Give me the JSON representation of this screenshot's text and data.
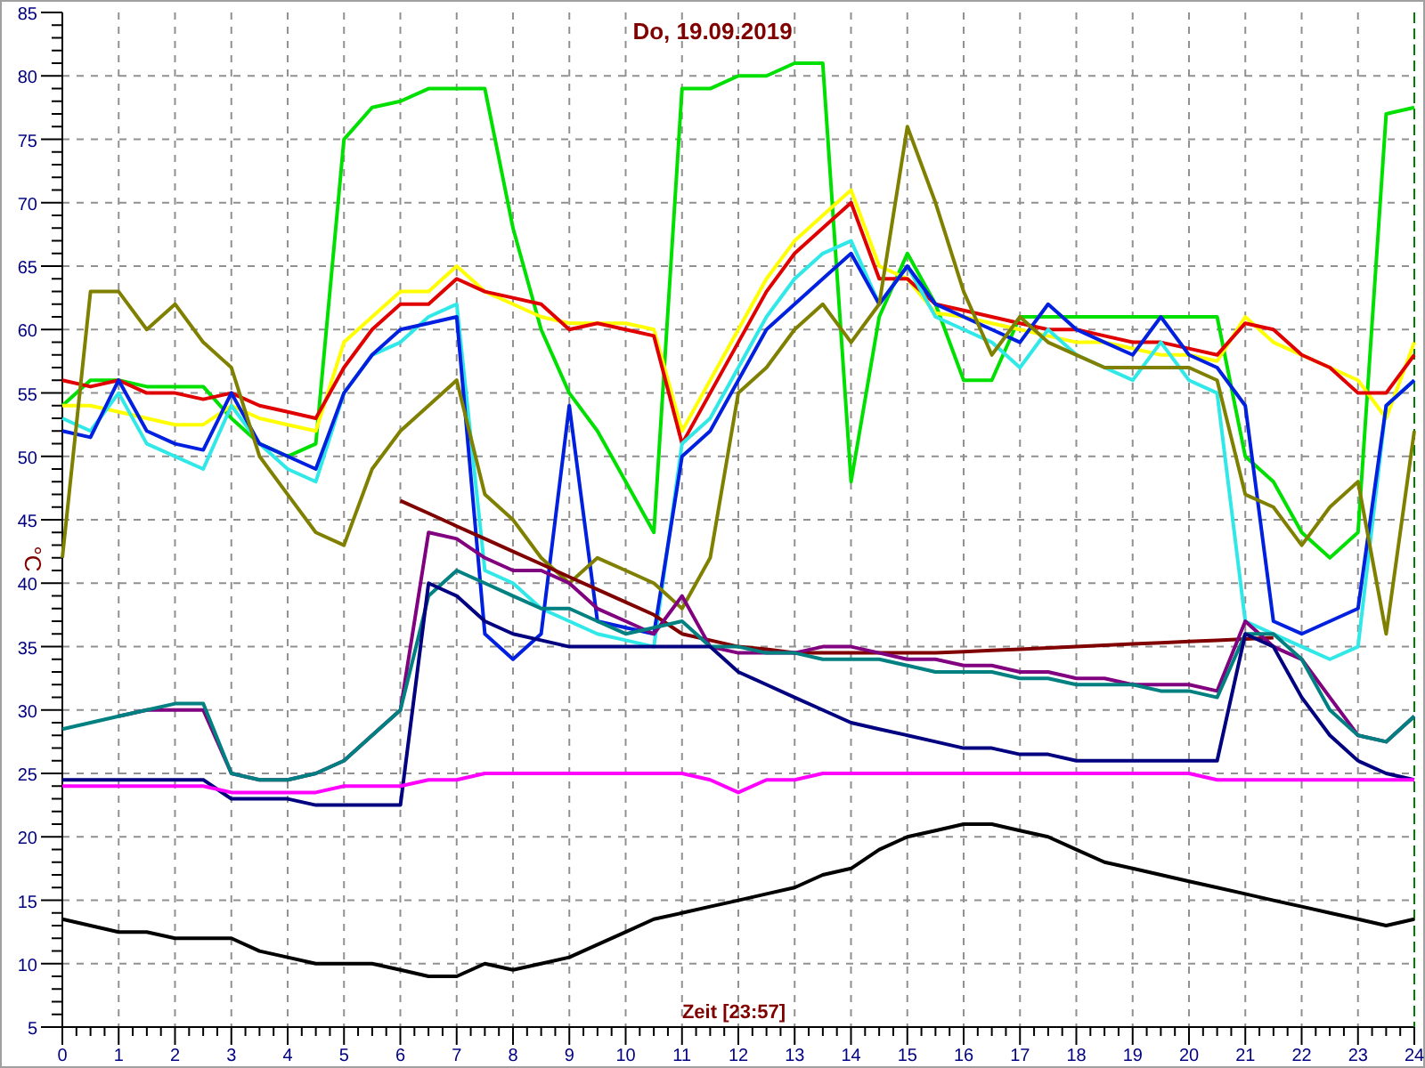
{
  "chart": {
    "chart_data": {
      "type": "line",
      "grid": true,
      "title": "Do, 19.09.2019",
      "xlabel": "Zeit [23:57]",
      "ylabel": "°C",
      "xlim": [
        0,
        24
      ],
      "ylim": [
        5,
        85
      ],
      "xticks": [
        0,
        1,
        2,
        3,
        4,
        5,
        6,
        7,
        8,
        9,
        10,
        11,
        12,
        13,
        14,
        15,
        16,
        17,
        18,
        19,
        20,
        21,
        22,
        23,
        24
      ],
      "yticks": [
        5,
        10,
        15,
        20,
        25,
        30,
        35,
        40,
        45,
        50,
        55,
        60,
        65,
        70,
        75,
        80,
        85
      ],
      "x": [
        0,
        0.5,
        1,
        1.5,
        2,
        2.5,
        3,
        3.5,
        4,
        4.5,
        5,
        5.5,
        6,
        6.5,
        7,
        7.5,
        8,
        8.5,
        9,
        9.5,
        10,
        10.5,
        11,
        11.5,
        12,
        12.5,
        13,
        13.5,
        14,
        14.5,
        15,
        15.5,
        16,
        16.5,
        17,
        17.5,
        18,
        18.5,
        19,
        19.5,
        20,
        20.5,
        21,
        21.5,
        22,
        22.5,
        23,
        23.5,
        24
      ],
      "series": [
        {
          "color": "#00e000",
          "values": [
            54,
            56,
            56,
            55.5,
            55.5,
            55.5,
            53,
            51,
            50,
            51,
            75,
            77.5,
            78,
            79,
            79,
            79,
            68,
            60,
            55,
            52,
            48,
            44,
            79,
            79,
            80,
            80,
            81,
            81,
            48,
            61,
            66,
            62,
            56,
            56,
            61,
            61,
            61,
            61,
            61,
            61,
            61,
            61,
            50,
            48,
            44,
            42,
            44,
            77,
            77.5
          ]
        },
        {
          "color": "#ffff00",
          "values": [
            54,
            54,
            53.5,
            53,
            52.5,
            52.5,
            54,
            53,
            52.5,
            52,
            59,
            61,
            63,
            63,
            65,
            63,
            62,
            61,
            60.5,
            60.5,
            60.5,
            60,
            52,
            56,
            60,
            64,
            67,
            69,
            71,
            65,
            64,
            61.3,
            61,
            60.5,
            60,
            59.5,
            59,
            59,
            58.5,
            58,
            58,
            57.5,
            61,
            59,
            58,
            57,
            56,
            53,
            59
          ]
        },
        {
          "color": "#e00000",
          "values": [
            56,
            55.5,
            56,
            55,
            55,
            54.5,
            55,
            54,
            53.5,
            53,
            57,
            60,
            62,
            62,
            64,
            63,
            62.5,
            62,
            60,
            60.5,
            60,
            59.5,
            51,
            55,
            59,
            63,
            66,
            68,
            70,
            64,
            64,
            62,
            61.5,
            61,
            60.5,
            60,
            60,
            59.5,
            59,
            59,
            58.5,
            58,
            60.5,
            60,
            58,
            57,
            55,
            55,
            58
          ]
        },
        {
          "color": "#30e8e8",
          "values": [
            53,
            52,
            55,
            51,
            50,
            49,
            54,
            51,
            49,
            48,
            55,
            58,
            59,
            61,
            62,
            41,
            40,
            38,
            37,
            36,
            35.5,
            35,
            51,
            53,
            57,
            61,
            64,
            66,
            67,
            62,
            65,
            61,
            60,
            59,
            57,
            60,
            58,
            57,
            56,
            59,
            56,
            55,
            37,
            36,
            35,
            34,
            35,
            54,
            56
          ]
        },
        {
          "color": "#0020e0",
          "values": [
            52,
            51.5,
            56,
            52,
            51,
            50.5,
            55,
            51,
            50,
            49,
            55,
            58,
            60,
            60.5,
            61,
            36,
            34,
            36,
            54,
            37,
            36.5,
            36,
            50,
            52,
            56,
            60,
            62,
            64,
            66,
            62,
            65,
            62,
            61,
            60,
            59,
            62,
            60,
            59,
            58,
            61,
            58,
            57,
            54,
            37,
            36,
            37,
            38,
            54,
            56
          ]
        },
        {
          "color": "#808000",
          "values": [
            42,
            63,
            63,
            60,
            62,
            59,
            57,
            50,
            47,
            44,
            43,
            49,
            52,
            54,
            56,
            47,
            45,
            42,
            40,
            42,
            41,
            40,
            38,
            42,
            55,
            57,
            60,
            62,
            59,
            62,
            76,
            70,
            63,
            58,
            61,
            59,
            58,
            57,
            57,
            57,
            57,
            56,
            47,
            46,
            43,
            46,
            48,
            36,
            52
          ]
        },
        {
          "color": "#800000",
          "values": [
            null,
            null,
            null,
            null,
            null,
            null,
            null,
            null,
            null,
            null,
            null,
            null,
            46.5,
            45.5,
            44.5,
            43.5,
            42.5,
            41.5,
            40.5,
            39.5,
            38.5,
            37.5,
            36,
            35.5,
            35,
            34.8,
            34.5,
            34.5,
            34.5,
            34.5,
            34.5,
            34.5,
            34.6,
            34.7,
            34.8,
            34.9,
            35,
            35.1,
            35.2,
            35.3,
            35.4,
            35.5,
            35.6,
            35.7,
            null,
            null,
            null,
            null,
            null
          ]
        },
        {
          "color": "#800080",
          "values": [
            null,
            null,
            29.5,
            30,
            30,
            30,
            25,
            24.5,
            24.5,
            25,
            26,
            28,
            30,
            44,
            43.5,
            42,
            41,
            41,
            40,
            38,
            37,
            36,
            39,
            35,
            34.5,
            34.5,
            34.5,
            35,
            35,
            34.5,
            34,
            34,
            33.5,
            33.5,
            33,
            33,
            32.5,
            32.5,
            32,
            32,
            32,
            31.5,
            37,
            35,
            34,
            31,
            28,
            27.5,
            29.5
          ]
        },
        {
          "color": "#008080",
          "values": [
            28.5,
            29,
            29.5,
            30,
            30.5,
            30.5,
            25,
            24.5,
            24.5,
            25,
            26,
            28,
            30,
            39,
            41,
            40,
            39,
            38,
            38,
            37,
            36,
            36.5,
            37,
            35,
            35,
            34.5,
            34.5,
            34,
            34,
            34,
            33.5,
            33,
            33,
            33,
            32.5,
            32.5,
            32,
            32,
            32,
            31.5,
            31.5,
            31,
            36,
            36,
            34,
            30,
            28,
            27.5,
            29.5
          ]
        },
        {
          "color": "#000080",
          "values": [
            24.5,
            24.5,
            24.5,
            24.5,
            24.5,
            24.5,
            23,
            23,
            23,
            22.5,
            22.5,
            22.5,
            22.5,
            40,
            39,
            37,
            36,
            35.5,
            35,
            35,
            35,
            35,
            35,
            35,
            33,
            32,
            31,
            30,
            29,
            28.5,
            28,
            27.5,
            27,
            27,
            26.5,
            26.5,
            26,
            26,
            26,
            26,
            26,
            26,
            36,
            35,
            31,
            28,
            26,
            25,
            24.5
          ]
        },
        {
          "color": "#ff00ff",
          "values": [
            24,
            24,
            24,
            24,
            24,
            24,
            23.5,
            23.5,
            23.5,
            23.5,
            24,
            24,
            24,
            24.5,
            24.5,
            25,
            25,
            25,
            25,
            25,
            25,
            25,
            25,
            24.5,
            23.5,
            24.5,
            24.5,
            25,
            25,
            25,
            25,
            25,
            25,
            25,
            25,
            25,
            25,
            25,
            25,
            25,
            25,
            24.5,
            24.5,
            24.5,
            24.5,
            24.5,
            24.5,
            24.5,
            24.5
          ]
        },
        {
          "color": "#000000",
          "values": [
            13.5,
            13,
            12.5,
            12.5,
            12,
            12,
            12,
            11,
            10.5,
            10,
            10,
            10,
            9.5,
            9,
            9,
            10,
            9.5,
            10,
            10.5,
            11.5,
            12.5,
            13.5,
            14,
            14.5,
            15,
            15.5,
            16,
            17,
            17.5,
            19,
            20,
            20.5,
            21,
            21,
            20.5,
            20,
            19,
            18,
            17.5,
            17,
            16.5,
            16,
            15.5,
            15,
            14.5,
            14,
            13.5,
            13,
            13.5
          ]
        }
      ]
    }
  }
}
